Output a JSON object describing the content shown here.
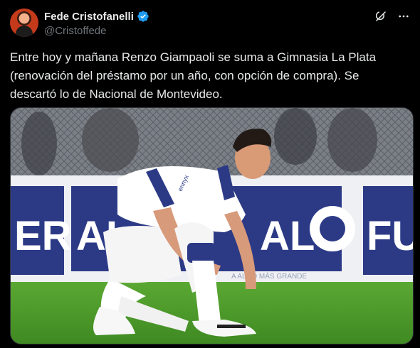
{
  "author": {
    "display_name": "Fede Cristofanelli",
    "handle": "@Cristoffede",
    "verified": true,
    "verified_color": "#1d9bf0"
  },
  "tweet": {
    "text": "Entre hoy y mañana Renzo Giampaoli se suma a Gimnasia La Plata (renovación del préstamo por un año, con opción de compra). Se descartó lo de Nacional de Montevideo."
  },
  "actions": {
    "grok_icon": "grok-icon",
    "more_icon": "more-icon"
  },
  "media": {
    "banner_text_left": "ER",
    "banner_text_mid": "AL",
    "banner_text_mid2": "AL",
    "banner_text_right": "FU",
    "banner_small_text": "A ALGO MÁS GRANDE",
    "jersey_sponsor": "ennyx"
  },
  "colors": {
    "background": "#000000",
    "text_primary": "#e7e9ea",
    "text_secondary": "#71767b",
    "banner_blue": "#2c3a86",
    "grass": "#4f9b2c"
  }
}
